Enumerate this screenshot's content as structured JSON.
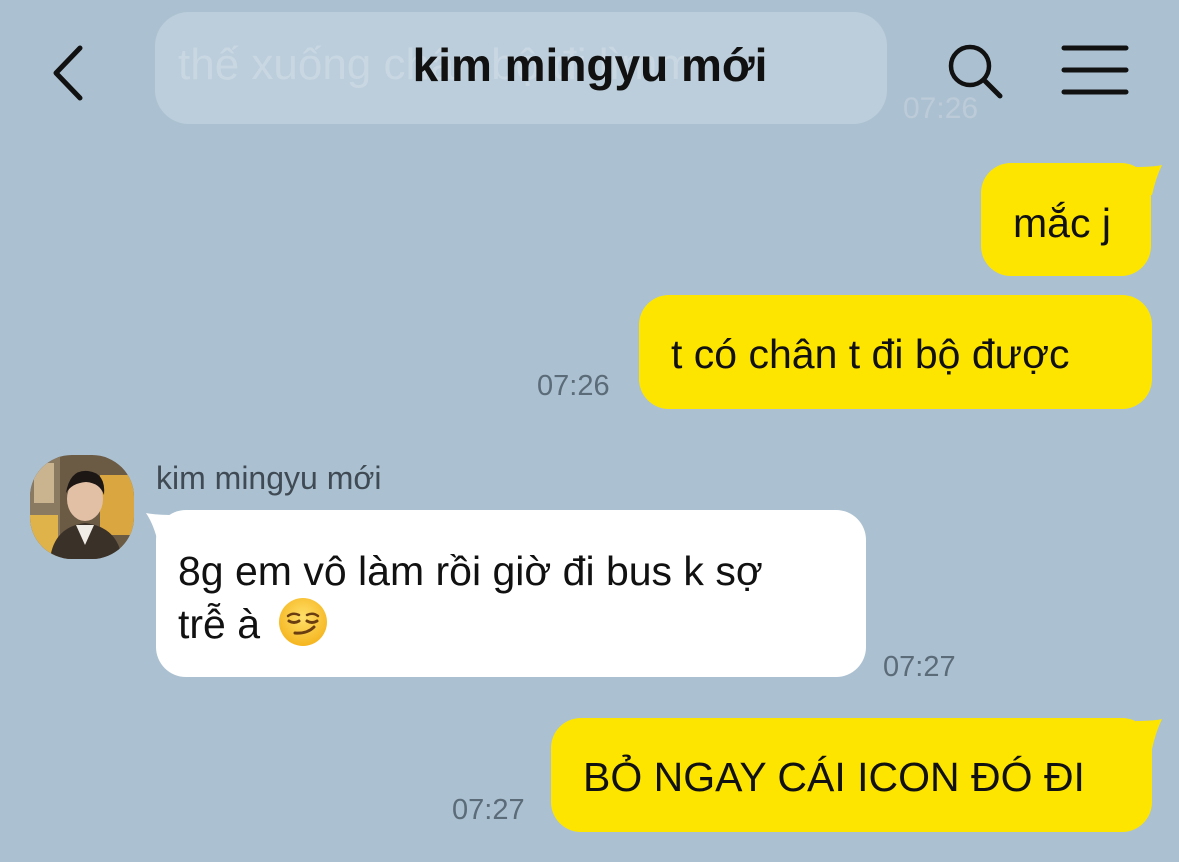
{
  "header": {
    "title": "kim mingyu mới",
    "back_icon": "chevron-left-icon",
    "search_icon": "search-icon",
    "menu_icon": "hamburger-menu-icon"
  },
  "ghost_message": {
    "text": "thế xuống chân bộ đi lìmm",
    "time": "07:26"
  },
  "messages": [
    {
      "from": "me",
      "text": "mắc j",
      "time": ""
    },
    {
      "from": "me",
      "text": "t có chân t đi bộ được",
      "time": "07:26"
    },
    {
      "from": "them",
      "sender": "kim mingyu mới",
      "line1": "8g em vô làm rồi giờ đi bus k sợ",
      "line2": "trễ à",
      "emoji": "😏",
      "time": "07:27"
    },
    {
      "from": "me",
      "text": "BỎ NGAY CÁI ICON ĐÓ ĐI",
      "time": "07:27"
    }
  ],
  "colors": {
    "background": "#abc1d1",
    "my_bubble": "#fee500",
    "their_bubble": "#ffffff"
  }
}
